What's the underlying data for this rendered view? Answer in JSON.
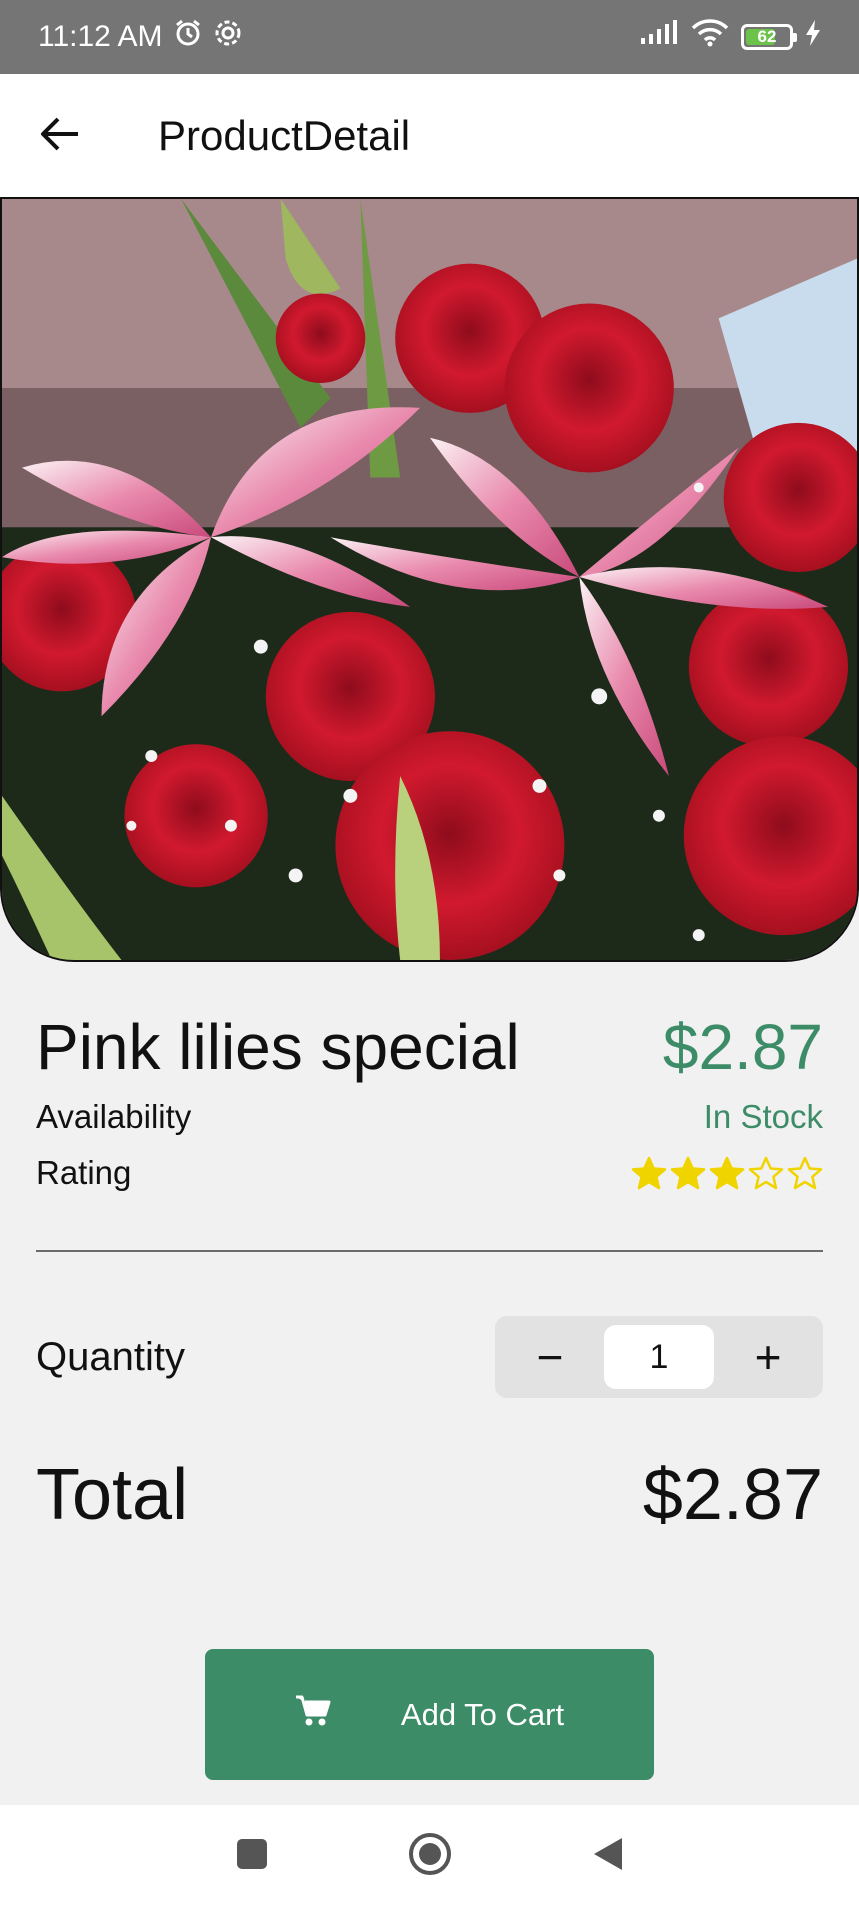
{
  "status_bar": {
    "time": "11:12 AM",
    "battery": "62"
  },
  "app_bar": {
    "title": "ProductDetail",
    "back_icon": "arrow-left-icon"
  },
  "product": {
    "name": "Pink lilies special",
    "price": "$2.87",
    "availability_label": "Availability",
    "availability_value": "In Stock",
    "rating_label": "Rating",
    "rating": 3,
    "rating_max": 5,
    "image": "pink-lilies-red-roses-bouquet"
  },
  "quantity": {
    "label": "Quantity",
    "value": "1",
    "minus": "−",
    "plus": "+"
  },
  "total": {
    "label": "Total",
    "value": "$2.87"
  },
  "cart_button": {
    "label": "Add To Cart",
    "icon": "cart-icon"
  },
  "colors": {
    "accent": "#3d8c68",
    "star": "#f0d400",
    "status_bar": "#757575"
  },
  "nav_icons": [
    "recents-square-icon",
    "home-circle-icon",
    "back-triangle-icon"
  ]
}
